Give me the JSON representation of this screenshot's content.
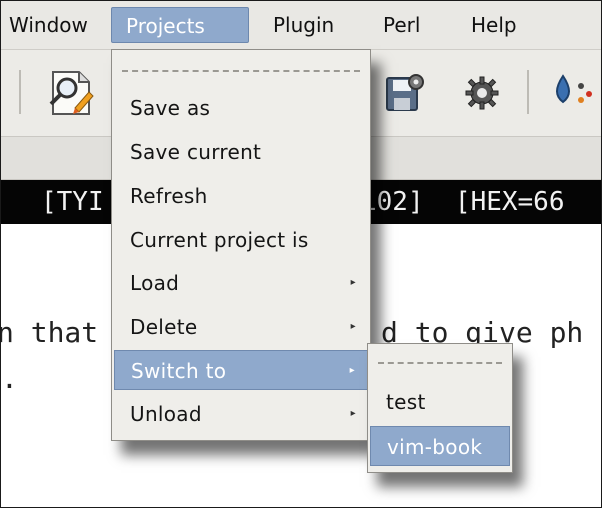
{
  "menubar": {
    "items": [
      {
        "label": "Window",
        "underline": "W"
      },
      {
        "label": "Projects",
        "underline": ""
      },
      {
        "label": "Plugin",
        "underline": ""
      },
      {
        "label": "Perl",
        "underline": "P"
      },
      {
        "label": "Help",
        "underline": "H"
      }
    ]
  },
  "toolbar": {
    "icons": [
      "find-replace-icon",
      "save-session-icon",
      "settings-gear-icon",
      "color-picker-icon"
    ]
  },
  "statusline": {
    "left_fragment": "[TYI",
    "right_fragment": "102]  [HEX=66"
  },
  "editor": {
    "line1_left": "n that",
    "line1_right": "d to give ph",
    "line2_left": "."
  },
  "projects_menu": {
    "items": [
      {
        "label": "Save as",
        "submenu": false
      },
      {
        "label": "Save current",
        "submenu": false
      },
      {
        "label": "Refresh",
        "submenu": false
      },
      {
        "label": "Current project is",
        "submenu": false
      },
      {
        "label": "Load",
        "submenu": true
      },
      {
        "label": "Delete",
        "submenu": true
      },
      {
        "label": "Switch to",
        "submenu": true
      },
      {
        "label": "Unload",
        "submenu": true
      }
    ],
    "submenu_arrow": "▸"
  },
  "switch_submenu": {
    "items": [
      {
        "label": "test"
      },
      {
        "label": "vim-book"
      }
    ]
  },
  "colors": {
    "highlight": "#8fa9cc",
    "menu_bg": "#efeeea",
    "statusline_bg": "#050505"
  }
}
